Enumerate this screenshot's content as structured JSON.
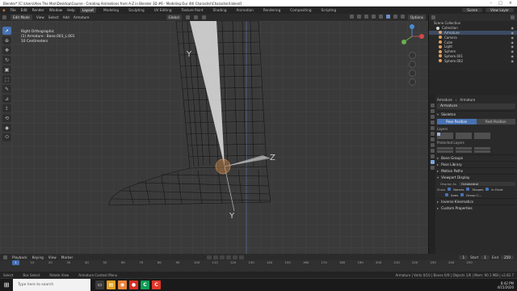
{
  "titlebar": {
    "text": "Blender* [C:\\Users\\Alex The Man\\Desktop\\Course - Creating Animations from A-Z in Blender 3D #6 - Modeling Our 4th Character\\Character4.blend]"
  },
  "menu": {
    "items": [
      "File",
      "Edit",
      "Render",
      "Window",
      "Help"
    ],
    "workspaces": [
      "Layout",
      "Modeling",
      "Sculpting",
      "UV Editing",
      "Texture Paint",
      "Shading",
      "Animation",
      "Rendering",
      "Compositing",
      "Scripting"
    ],
    "active_workspace": "Layout",
    "scene_label": "Scene",
    "view_layer_label": "View Layer"
  },
  "viewport_header": {
    "mode": "Edit Mode",
    "menus": [
      "View",
      "Select",
      "Add",
      "Armature"
    ],
    "transform": "Global",
    "options": "Options"
  },
  "viewport": {
    "view_name": "Right Orthographic",
    "selection": "(1) Armature : Bone.003_L.001",
    "units": "10 Centimeters",
    "axis_y_top": "Y",
    "axis_z": "Z",
    "axis_y_bottom": "Y"
  },
  "toolbar": {
    "icons": [
      "cursor-arrow",
      "select-box",
      "cursor",
      "move",
      "rotate",
      "scale",
      "transform",
      "annotate",
      "measure",
      "extrude",
      "roll",
      "bone-size",
      "envelope"
    ]
  },
  "outliner": {
    "title": "Scene Collection",
    "items": [
      {
        "label": "Collection",
        "color": "#d8d8d8",
        "selected": false
      },
      {
        "label": "Armature",
        "color": "#e0a060",
        "selected": true
      },
      {
        "label": "Camera",
        "color": "#e0a060",
        "selected": false
      },
      {
        "label": "Cube",
        "color": "#e0a060",
        "selected": false
      },
      {
        "label": "Light",
        "color": "#e0a060",
        "selected": false
      },
      {
        "label": "Sphere",
        "color": "#e0a060",
        "selected": false
      },
      {
        "label": "Sphere.001",
        "color": "#e0a060",
        "selected": false
      },
      {
        "label": "Sphere.002",
        "color": "#e0a060",
        "selected": false
      }
    ]
  },
  "properties": {
    "breadcrumb_1": "Armature",
    "breadcrumb_2": "Armature",
    "name_field": "Armature",
    "skeleton_panel": "Skeleton",
    "pose_position": "Pose Position",
    "rest_position": "Rest Position",
    "layers_label": "Layers",
    "protected_layers_label": "Protected Layers",
    "panels": [
      "Bone Groups",
      "Pose Library",
      "Motion Paths",
      "Viewport Display"
    ],
    "display_as_label": "Display As",
    "display_as_value": "Octahedral",
    "show_label": "Show",
    "names_label": "Names",
    "shapes_label": "Shapes",
    "in_front_label": "In Front",
    "axes_label": "Axes",
    "group_colors_label": "Group C...",
    "lower_panels": [
      "Inverse Kinematics",
      "Custom Properties"
    ]
  },
  "timeline": {
    "menus": [
      "Playback",
      "Keying",
      "View",
      "Marker"
    ],
    "current_frame": "1",
    "start_label": "Start",
    "start_value": "1",
    "end_label": "End",
    "end_value": "250",
    "ticks": [
      "10",
      "20",
      "30",
      "40",
      "50",
      "60",
      "70",
      "80",
      "90",
      "100",
      "110",
      "120",
      "130",
      "140",
      "150",
      "160",
      "170",
      "180",
      "190",
      "200",
      "210",
      "220",
      "230",
      "240",
      "250"
    ]
  },
  "statusbar": {
    "select": "Select",
    "box_select": "Box Select",
    "rotate_view": "Rotate View",
    "context_menu": "Armature Context Menu",
    "stats": "Armature | Verts 0/10 | Bones 0/9 | Objects 1/6 | Mem: 90.1 MiB | v2.82.7"
  },
  "taskbar": {
    "search_placeholder": "Type here to search",
    "time": "8:42 PM",
    "date": "4/15/2020"
  }
}
